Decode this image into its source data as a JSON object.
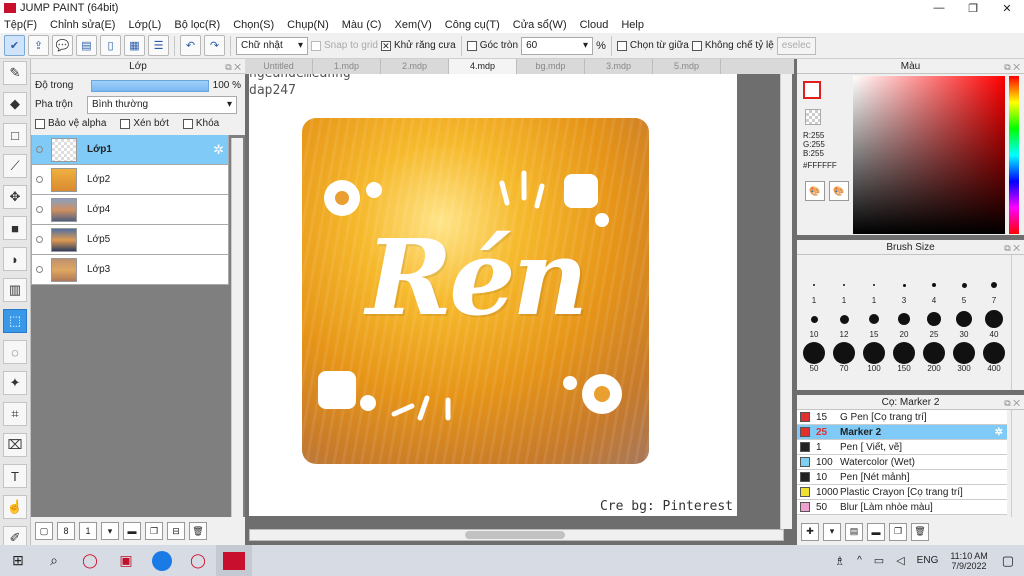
{
  "app": {
    "title": "JUMP PAINT (64bit)"
  },
  "window_controls": {
    "minimize": "—",
    "maximize": "❐",
    "close": "✕"
  },
  "menu": [
    "Tệp(F)",
    "Chỉnh sửa(E)",
    "Lớp(L)",
    "Bộ lọc(R)",
    "Chọn(S)",
    "Chụp(N)",
    "Màu (C)",
    "Xem(V)",
    "Công cụ(T)",
    "Cửa sổ(W)",
    "Cloud",
    "Help"
  ],
  "toolbar": {
    "shape_select": "Chữ nhật",
    "snap_to_grid": "Snap to grid",
    "antialias": "Khử răng cưa",
    "round_corner": "Góc tròn",
    "round_value": "60",
    "percent": "%",
    "select_center": "Chọn từ giữa",
    "no_ratio": "Không chế tỷ lệ",
    "deselect": "eselec"
  },
  "layer_panel": {
    "title": "Lớp",
    "opacity_label": "Độ trong",
    "opacity_value": "100 %",
    "blend_label": "Pha trộn",
    "blend_value": "Bình thường",
    "protect_alpha": "Bảo vệ alpha",
    "clip": "Xén bớt",
    "lock": "Khóa",
    "layers": [
      {
        "name": "Lớp1",
        "selected": true
      },
      {
        "name": "Lớp2",
        "selected": false
      },
      {
        "name": "Lớp4",
        "selected": false
      },
      {
        "name": "Lớp5",
        "selected": false
      },
      {
        "name": "Lớp3",
        "selected": false
      }
    ]
  },
  "tabs": [
    "Untitled",
    "1.mdp",
    "2.mdp",
    "4.mdp",
    "bg.mdp",
    "3.mdp",
    "5.mdp"
  ],
  "active_tab": "4.mdp",
  "canvas": {
    "watermark_line1": "ngeandemeanng",
    "watermark_line2": "dap247",
    "artwork_text": "Rén",
    "credit": "Cre bg: Pinterest"
  },
  "color_panel": {
    "title": "Màu",
    "r": "R:255",
    "g": "G:255",
    "b": "B:255",
    "hex": "#FFFFFF",
    "accent": "#3a98e8"
  },
  "brush_panel": {
    "title": "Brush Size",
    "sizes": [
      "1",
      "1",
      "1",
      "3",
      "4",
      "5",
      "7",
      "10",
      "12",
      "15",
      "20",
      "25",
      "30",
      "40",
      "50",
      "70",
      "100",
      "150",
      "200",
      "300",
      "400"
    ]
  },
  "marker_panel": {
    "title": "Cọ: Marker 2",
    "items": [
      {
        "size": "15",
        "name": "G Pen [Cọ trang trí]",
        "color": "#e03030"
      },
      {
        "size": "25",
        "name": "Marker 2",
        "color": "#e03030",
        "selected": true
      },
      {
        "size": "1",
        "name": "Pen [ Viết, vẽ]",
        "color": "#222222"
      },
      {
        "size": "100",
        "name": "Watercolor (Wet)",
        "color": "#7fd0f0"
      },
      {
        "size": "10",
        "name": "Pen [Nét mảnh]",
        "color": "#222222"
      },
      {
        "size": "1000",
        "name": "Plastic Crayon [Cọ trang trí]",
        "color": "#f0e030"
      },
      {
        "size": "50",
        "name": "Blur [Làm nhòe màu]",
        "color": "#f0a0d0"
      }
    ]
  },
  "taskbar": {
    "lang": "ENG",
    "time": "11:10 AM",
    "date": "7/9/2022"
  }
}
